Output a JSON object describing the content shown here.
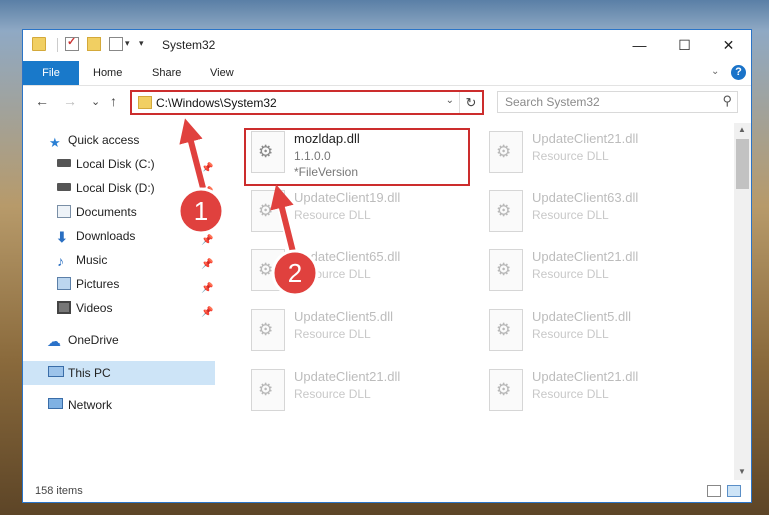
{
  "window": {
    "title": "System32",
    "controls": {
      "minimize": "—",
      "maximize": "☐",
      "close": "✕"
    }
  },
  "ribbon": {
    "file": "File",
    "tabs": [
      "Home",
      "Share",
      "View"
    ],
    "help": "?"
  },
  "nav": {
    "back": "←",
    "forward": "→",
    "recent": "⌄",
    "up": "↑",
    "address": "C:\\Windows\\System32",
    "search_placeholder": "Search System32"
  },
  "sidebar": {
    "quick_access": "Quick access",
    "pinned": [
      {
        "label": "Local Disk (C:)",
        "icon": "drive-icon"
      },
      {
        "label": "Local Disk (D:)",
        "icon": "drive-icon"
      },
      {
        "label": "Documents",
        "icon": "documents-icon"
      },
      {
        "label": "Downloads",
        "icon": "downloads-icon"
      },
      {
        "label": "Music",
        "icon": "music-icon"
      },
      {
        "label": "Pictures",
        "icon": "pictures-icon"
      },
      {
        "label": "Videos",
        "icon": "videos-icon"
      }
    ],
    "onedrive": "OneDrive",
    "this_pc": "This PC",
    "network": "Network"
  },
  "files": [
    {
      "name": "mozldap.dll",
      "sub": "1.1.0.0",
      "sub2": "*FileVersion",
      "highlight": true
    },
    {
      "name": "UpdateClient21.dll",
      "sub": "Resource DLL"
    },
    {
      "name": "UpdateClient19.dll",
      "sub": "Resource DLL"
    },
    {
      "name": "UpdateClient63.dll",
      "sub": "Resource DLL"
    },
    {
      "name": "UpdateClient65.dll",
      "sub": "Resource DLL"
    },
    {
      "name": "UpdateClient21.dll",
      "sub": "Resource DLL"
    },
    {
      "name": "UpdateClient5.dll",
      "sub": "Resource DLL"
    },
    {
      "name": "UpdateClient5.dll",
      "sub": "Resource DLL"
    },
    {
      "name": "UpdateClient21.dll",
      "sub": "Resource DLL"
    },
    {
      "name": "UpdateClient21.dll",
      "sub": "Resource DLL"
    }
  ],
  "status": {
    "items": "158 items"
  },
  "annotations": {
    "marker1": "1",
    "marker2": "2"
  },
  "colors": {
    "accent": "#1979ca",
    "highlight": "#cc2d2d",
    "selected_bg": "#cde4f7"
  }
}
